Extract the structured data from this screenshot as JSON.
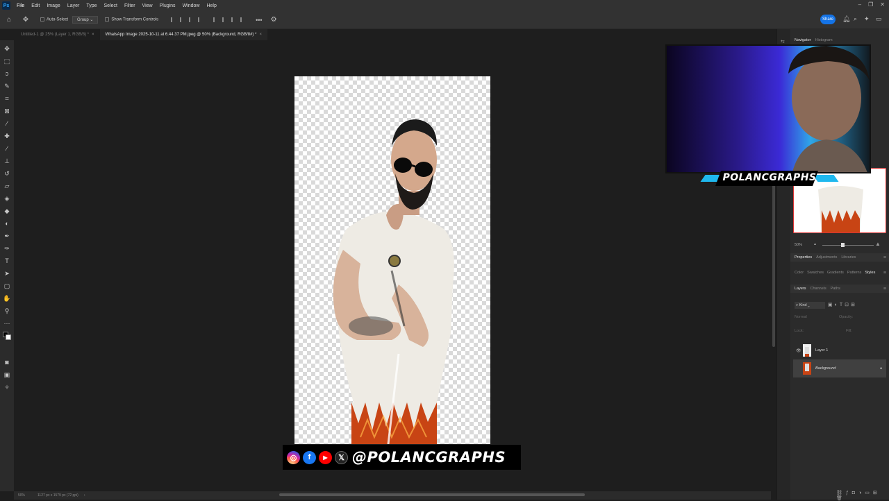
{
  "menubar": {
    "app_icon": "Ps",
    "items": [
      "File",
      "Edit",
      "Image",
      "Layer",
      "Type",
      "Select",
      "Filter",
      "View",
      "Plugins",
      "Window",
      "Help"
    ]
  },
  "options": {
    "auto_select_label": "Auto-Select",
    "group_select": "Group",
    "show_transform_label": "Show Transform Controls",
    "share_label": "Share"
  },
  "tabs": [
    {
      "label": "Untitled-1 @ 25% (Layer 1, RGB/8) *"
    },
    {
      "label": "WhatsApp Image 2025-10-11 at 6.44.37 PM.jpeg @ 50% (Background, RGB/8#) *"
    }
  ],
  "status": {
    "zoom": "50%",
    "dimensions": "1127 px x 1579 px (72 ppi)"
  },
  "panels": {
    "navigator_tabs": [
      "Navigator",
      "Histogram"
    ],
    "nav_zoom": "50%",
    "properties_tabs": [
      "Properties",
      "Adjustments",
      "Libraries"
    ],
    "color_tabs": [
      "Color",
      "Swatches",
      "Gradients",
      "Patterns",
      "Styles"
    ],
    "layers_tabs": [
      "Layers",
      "Channels",
      "Paths"
    ],
    "kind_label": "Kind",
    "blend_mode": "Normal",
    "opacity_label": "Opacity:",
    "lock_label": "Lock:",
    "fill_label": "Fill:",
    "layers": [
      {
        "name": "Layer 1",
        "visible": true
      },
      {
        "name": "Background",
        "locked": true
      }
    ]
  },
  "overlay": {
    "brand_name": "POLANCGRAPHS",
    "social_handle": "@POLANCGRAPHS",
    "social_icons": [
      "instagram-icon",
      "facebook-icon",
      "youtube-icon",
      "x-icon"
    ]
  },
  "colors": {
    "accent": "#1473e6",
    "brand_cyan": "#1fb8ee",
    "app_bg": "#1e1e1e",
    "panel_bg": "#2b2b2b"
  }
}
